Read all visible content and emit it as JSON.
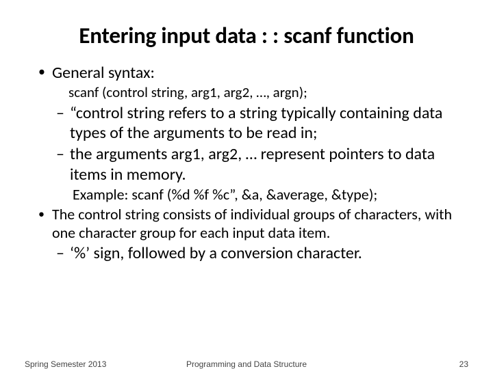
{
  "title": "Entering input data : : scanf function",
  "bullets": {
    "b1": "General syntax:",
    "b1_code": "scanf (control string, arg1, arg2, …, argn);",
    "b1_sub1": "“control string refers to a string typically containing data types of the arguments to be read in;",
    "b1_sub2": "the arguments arg1, arg2, … represent pointers to data items in memory.",
    "b1_example": "Example:  scanf (%d %f %c”, &a, &average, &type);",
    "b2": "The control string consists of individual groups of characters, with one character group for each input data item.",
    "b2_sub1": "‘%’ sign, followed by a conversion character."
  },
  "footer": {
    "left": "Spring Semester 2013",
    "center": "Programming and Data Structure",
    "page": "23"
  }
}
